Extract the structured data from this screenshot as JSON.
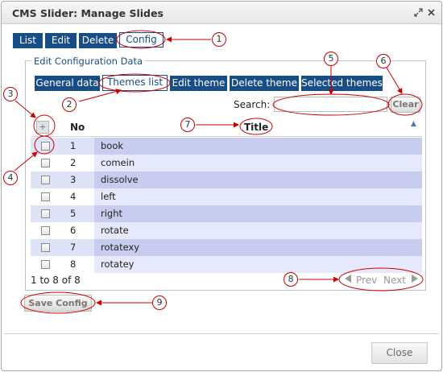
{
  "window": {
    "title": "CMS Slider: Manage Slides",
    "expand_icon": "expand-icon",
    "close_icon": "close-icon"
  },
  "main_tabs": [
    {
      "label": "List"
    },
    {
      "label": "Edit"
    },
    {
      "label": "Delete"
    },
    {
      "label": "Config",
      "active": true
    }
  ],
  "config": {
    "legend": "Edit Configuration Data",
    "tabs": [
      {
        "label": "General data"
      },
      {
        "label": "Themes list",
        "active": true
      },
      {
        "label": "Edit theme"
      },
      {
        "label": "Delete theme"
      },
      {
        "label": "Selected themes"
      }
    ],
    "search_label": "Search:",
    "search_value": "",
    "clear_label": "Clear",
    "columns": {
      "add": "+",
      "no": "No",
      "title": "Title"
    },
    "rows": [
      {
        "no": "1",
        "title": "book"
      },
      {
        "no": "2",
        "title": "comein"
      },
      {
        "no": "3",
        "title": "dissolve"
      },
      {
        "no": "4",
        "title": "left"
      },
      {
        "no": "5",
        "title": "right"
      },
      {
        "no": "6",
        "title": "rotate"
      },
      {
        "no": "7",
        "title": "rotatexy"
      },
      {
        "no": "8",
        "title": "rotatey"
      }
    ],
    "count_text": "1 to 8 of 8",
    "prev_label": "Prev",
    "next_label": "Next",
    "save_label": "Save Config"
  },
  "close_label": "Close",
  "callouts": [
    "1",
    "2",
    "3",
    "4",
    "5",
    "6",
    "7",
    "8",
    "9"
  ],
  "colors": {
    "tab_bg": "#184e87",
    "annotation": "#cc0000",
    "row_alt": "#c8cdef"
  }
}
